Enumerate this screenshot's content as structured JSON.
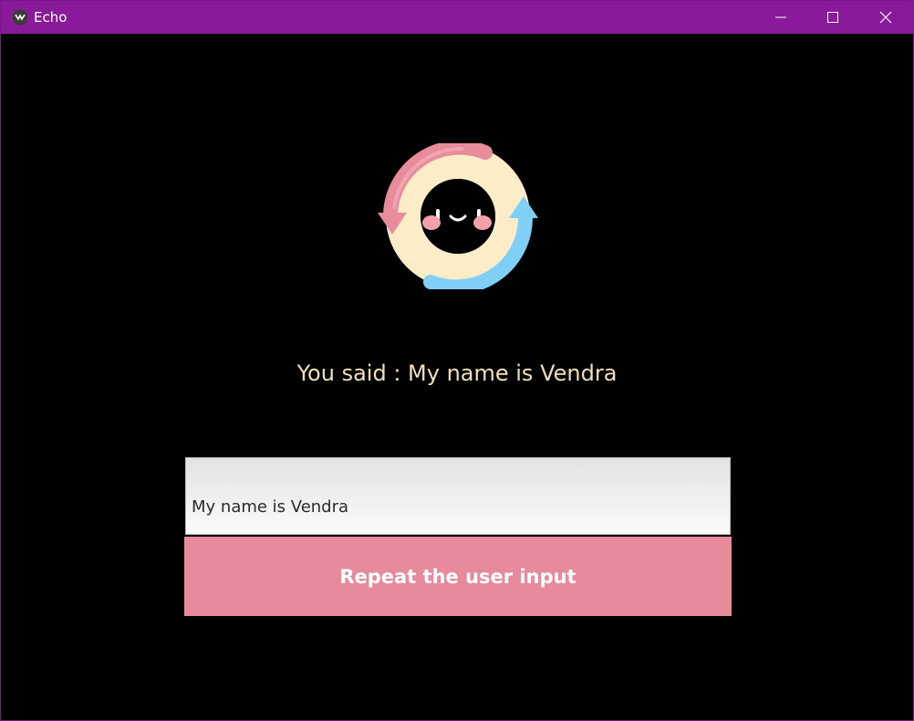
{
  "window": {
    "title": "Echo",
    "title_bar_color": "#891a9a",
    "app_icon": "kivy-logo-icon",
    "controls": {
      "minimize_icon": "minimize-icon",
      "maximize_icon": "maximize-icon",
      "close_icon": "close-icon"
    }
  },
  "main": {
    "logo_icon": "echo-sync-face-logo",
    "echo_text": "You said : My name is Vendra",
    "echo_text_color": "#f3dfb8",
    "input_value": "My name is Vendra",
    "button_label": "Repeat the user input",
    "button_color": "#e68a9c"
  }
}
